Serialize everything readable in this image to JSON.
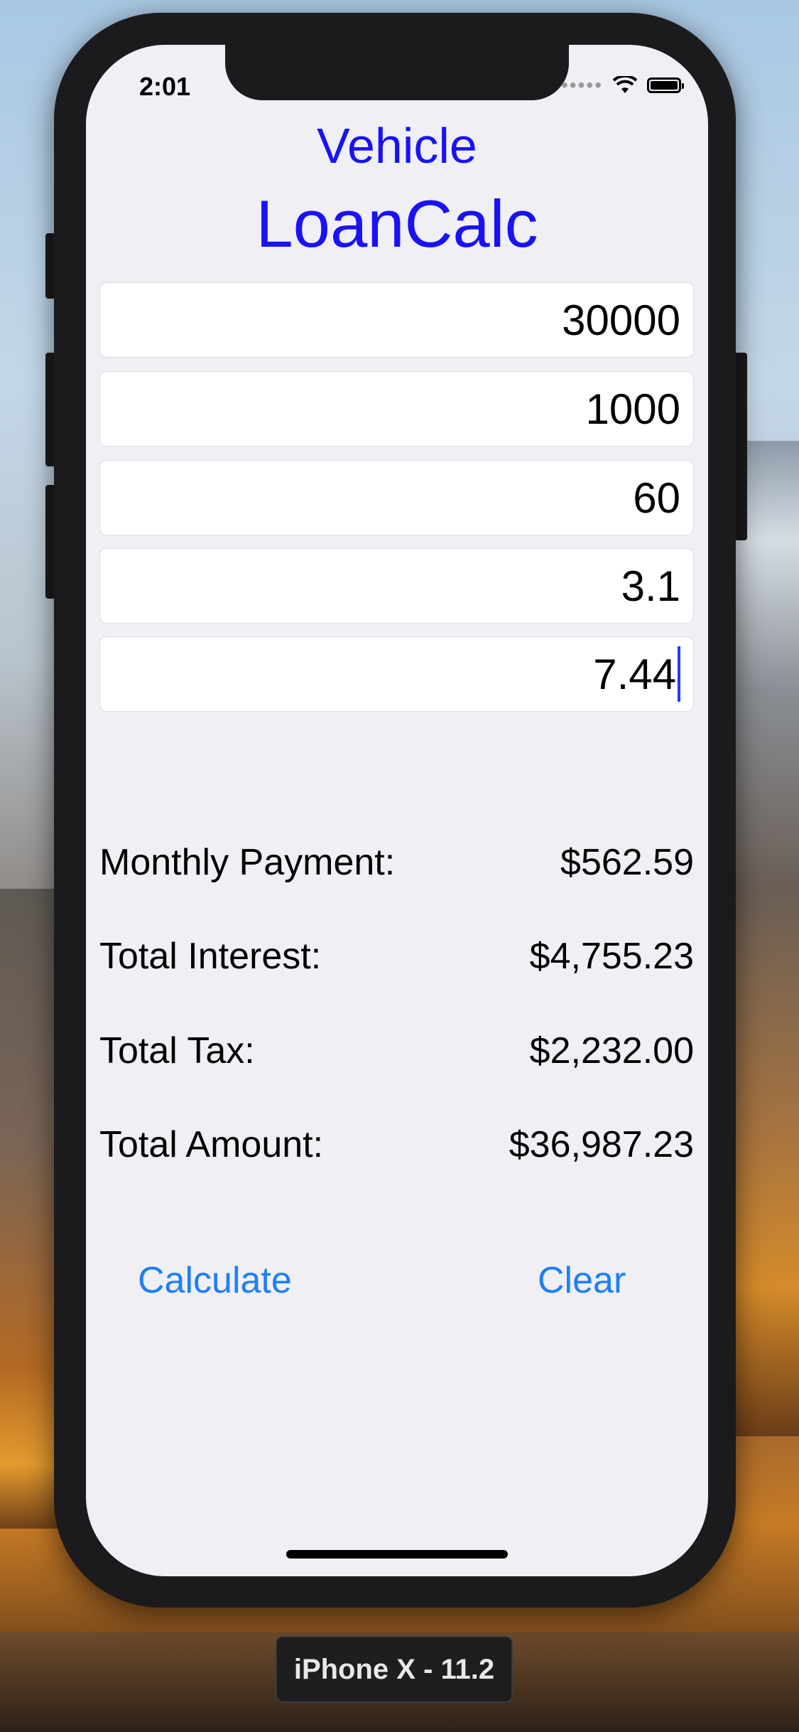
{
  "status_bar": {
    "time": "2:01"
  },
  "app": {
    "title_line1": "Vehicle",
    "title_line2": "LoanCalc"
  },
  "inputs": [
    {
      "value": "30000"
    },
    {
      "value": "1000"
    },
    {
      "value": "60"
    },
    {
      "value": "3.1"
    },
    {
      "value": "7.44"
    }
  ],
  "results": [
    {
      "label": "Monthly Payment:",
      "value": "$562.59"
    },
    {
      "label": "Total Interest:",
      "value": "$4,755.23"
    },
    {
      "label": "Total Tax:",
      "value": "$2,232.00"
    },
    {
      "label": "Total Amount:",
      "value": "$36,987.23"
    }
  ],
  "buttons": {
    "calculate": "Calculate",
    "clear": "Clear"
  },
  "simulator": {
    "device_label": "iPhone X - 11.2"
  },
  "colors": {
    "title": "#1a12f5",
    "button": "#1e7ff5",
    "screen_bg": "#efeff4"
  }
}
